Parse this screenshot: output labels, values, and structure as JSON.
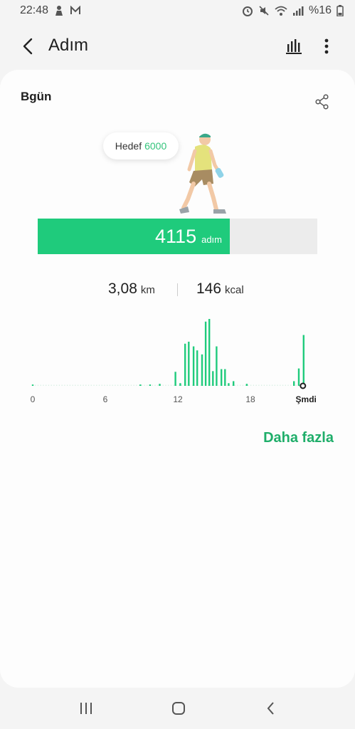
{
  "status_bar": {
    "time": "22:48",
    "battery": "%16"
  },
  "header": {
    "title": "Adım"
  },
  "card": {
    "title": "Bgün",
    "goal_label": "Hedef",
    "goal_value": "6000",
    "steps": "4115",
    "steps_unit": "adım",
    "goal_progress": 0.686,
    "distance": "3,08",
    "distance_unit": "km",
    "calories": "146",
    "calories_unit": "kcal",
    "more_link": "Daha fazla"
  },
  "chart_data": {
    "type": "bar",
    "x_ticks": [
      "0",
      "6",
      "12",
      "18",
      "Şmdi"
    ],
    "ylim": [
      0,
      100
    ],
    "color": "#1fcb7c",
    "bars": [
      {
        "hour": 0.0,
        "value": 2
      },
      {
        "hour": 8.9,
        "value": 2
      },
      {
        "hour": 9.7,
        "value": 2
      },
      {
        "hour": 10.5,
        "value": 3
      },
      {
        "hour": 11.8,
        "value": 21
      },
      {
        "hour": 12.2,
        "value": 4
      },
      {
        "hour": 12.6,
        "value": 63
      },
      {
        "hour": 12.9,
        "value": 66
      },
      {
        "hour": 13.3,
        "value": 59
      },
      {
        "hour": 13.6,
        "value": 53
      },
      {
        "hour": 14.0,
        "value": 47
      },
      {
        "hour": 14.3,
        "value": 96
      },
      {
        "hour": 14.6,
        "value": 100
      },
      {
        "hour": 14.9,
        "value": 22
      },
      {
        "hour": 15.2,
        "value": 59
      },
      {
        "hour": 15.6,
        "value": 25
      },
      {
        "hour": 15.9,
        "value": 25
      },
      {
        "hour": 16.2,
        "value": 4
      },
      {
        "hour": 16.6,
        "value": 7
      },
      {
        "hour": 17.7,
        "value": 3
      },
      {
        "hour": 21.6,
        "value": 7
      },
      {
        "hour": 22.0,
        "value": 26
      },
      {
        "hour": 22.4,
        "value": 76
      }
    ]
  },
  "icons": {
    "back": "arrow-left-icon",
    "chart": "bar-chart-icon",
    "more": "more-vertical-icon",
    "share": "share-icon"
  }
}
